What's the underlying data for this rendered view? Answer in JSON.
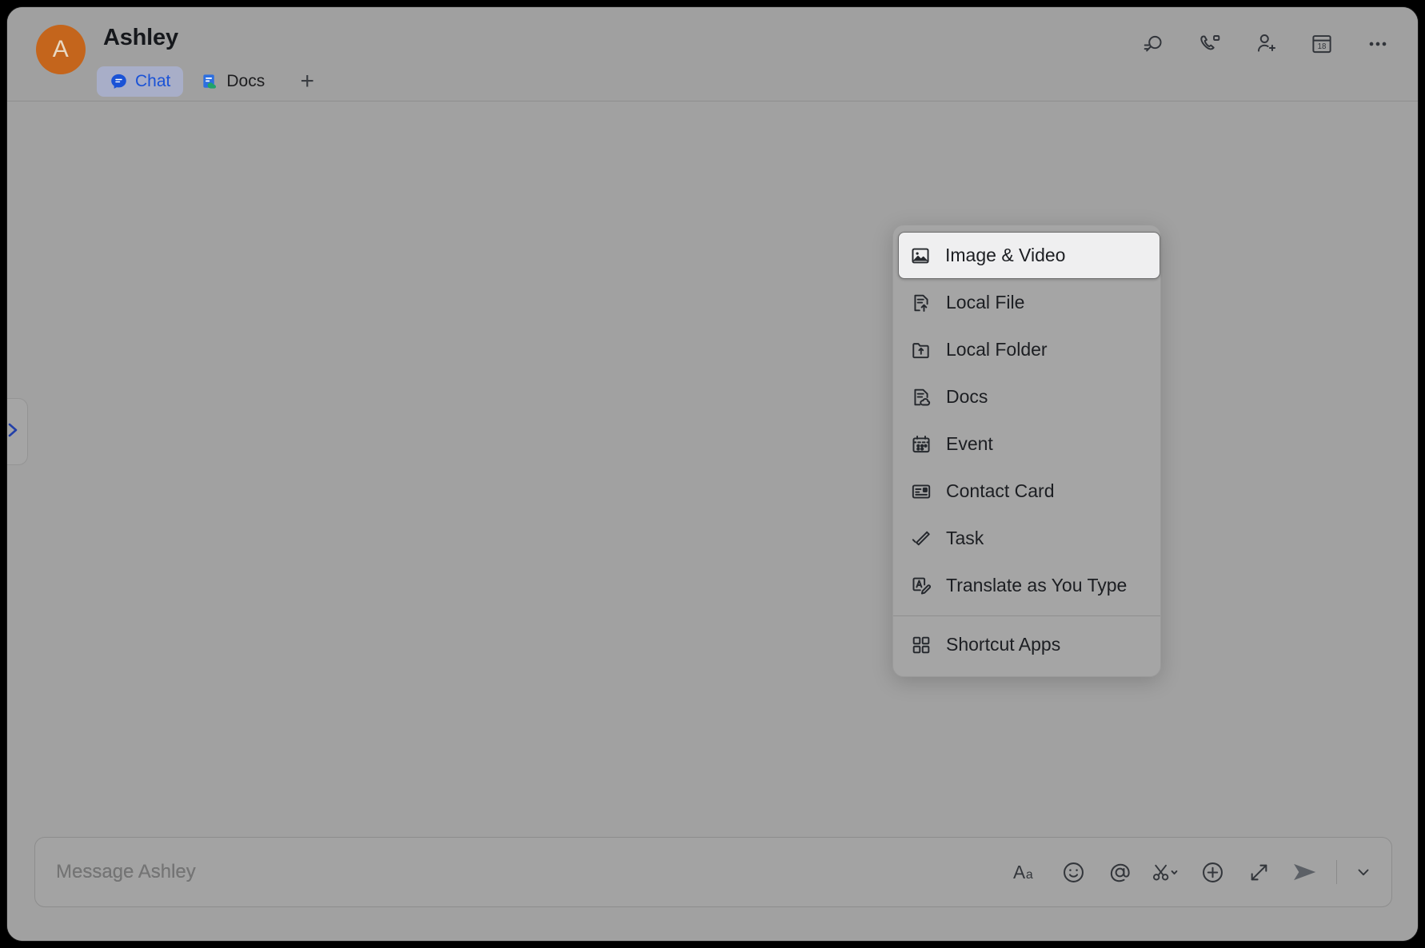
{
  "window": {
    "contact_name": "Ashley",
    "avatar_initial": "A"
  },
  "header": {
    "tabs": [
      {
        "label": "Chat",
        "icon": "chat-bubble-icon",
        "active": true
      },
      {
        "label": "Docs",
        "icon": "docs-icon",
        "active": false
      }
    ],
    "add_tab_label": "+",
    "actions": [
      {
        "name": "search-icon",
        "label": "Search"
      },
      {
        "name": "video-call-icon",
        "label": "Video Call"
      },
      {
        "name": "add-person-icon",
        "label": "Add Member"
      },
      {
        "name": "calendar-icon",
        "label": "Calendar",
        "badge": "18"
      },
      {
        "name": "more-options-icon",
        "label": "More"
      }
    ]
  },
  "side_panel": {
    "expand_label": "Expand panel",
    "chevron_color": "#2340a8"
  },
  "attach_menu": {
    "groups": [
      {
        "items": [
          {
            "label": "Image & Video",
            "icon": "image-icon",
            "highlighted": true
          },
          {
            "label": "Local File",
            "icon": "file-upload-icon",
            "highlighted": false
          },
          {
            "label": "Local Folder",
            "icon": "folder-upload-icon",
            "highlighted": false
          },
          {
            "label": "Docs",
            "icon": "cloud-doc-icon",
            "highlighted": false
          },
          {
            "label": "Event",
            "icon": "calendar-event-icon",
            "highlighted": false
          },
          {
            "label": "Contact Card",
            "icon": "contact-card-icon",
            "highlighted": false
          },
          {
            "label": "Task",
            "icon": "task-check-icon",
            "highlighted": false
          },
          {
            "label": "Translate as You Type",
            "icon": "translate-icon",
            "highlighted": false
          }
        ]
      },
      {
        "items": [
          {
            "label": "Shortcut Apps",
            "icon": "grid-apps-icon",
            "highlighted": false
          }
        ]
      }
    ]
  },
  "composer": {
    "placeholder": "Message Ashley",
    "value": "",
    "tools": [
      {
        "name": "format-text-icon",
        "label": "Aa"
      },
      {
        "name": "emoji-icon",
        "label": "Emoji"
      },
      {
        "name": "mention-icon",
        "label": "Mention"
      },
      {
        "name": "clip-scissors-icon",
        "label": "Clip"
      },
      {
        "name": "add-attachment-icon",
        "label": "More"
      },
      {
        "name": "expand-icon",
        "label": "Expand"
      }
    ],
    "send_label": "Send",
    "send_options_label": "Send options"
  },
  "colors": {
    "accent_blue": "#1a52d6",
    "avatar_orange": "#c4651c",
    "tab_active_bg": "#a8aec8",
    "window_bg": "#a1a1a1",
    "menu_bg": "#a5a5a5",
    "highlight_bg": "#efeff0"
  }
}
